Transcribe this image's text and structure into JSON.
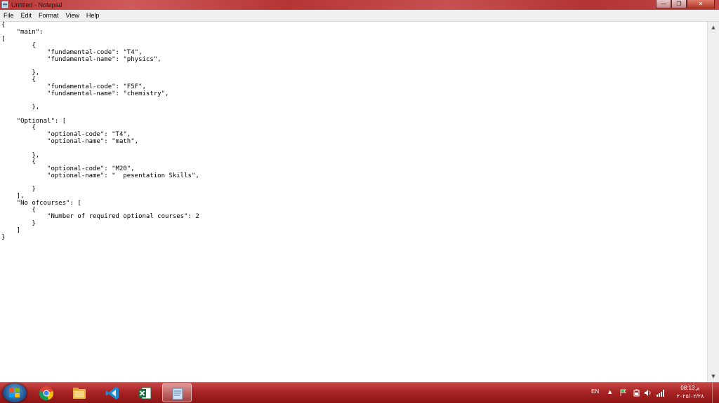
{
  "window": {
    "title": "Untitled - Notepad",
    "minimize": "—",
    "maximize": "❐",
    "close": "✕"
  },
  "menu": [
    "File",
    "Edit",
    "Format",
    "View",
    "Help"
  ],
  "editor": {
    "content": "{\n    \"main\":\n[\n        {\n            \"fundamental-code\": \"T4\",\n            \"fundamental-name\": \"physics\",\n\n        },\n        {\n            \"fundamental-code\": \"F5F\",\n            \"fundamental-name\": \"chemistry\",\n\n        },\n\n    \"Optional\": [\n        {\n            \"optional-code\": \"T4\",\n            \"optional-name\": \"math\",\n\n        },\n        {\n            \"optional-code\": \"M20\",\n            \"optional-name\": \"  pesentation Skills\",\n\n        }\n    ],\n    \"No ofcourses\": [\n        {\n            \"Number of required optional courses\": 2\n        }\n    ]\n}"
  },
  "taskbar": {
    "apps": [
      "chrome-icon",
      "file-explorer-icon",
      "vscode-icon",
      "excel-icon",
      "notepad-icon"
    ],
    "active_app": "notepad-icon",
    "language": "EN",
    "time": "08:13 م",
    "date": "٢٠٢٥/٠٢/٢٨"
  },
  "colors": {
    "titlebar": "#c04040",
    "taskbar": "#a82424",
    "editor_bg": "#ffffff"
  }
}
